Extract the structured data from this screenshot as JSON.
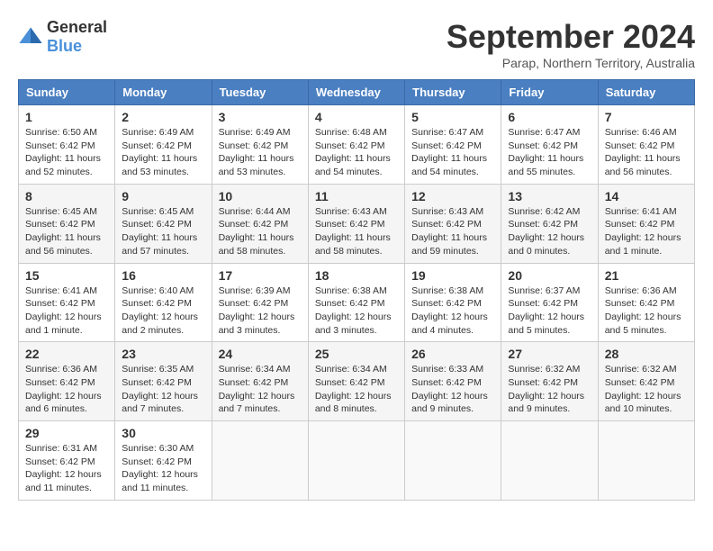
{
  "logo": {
    "general": "General",
    "blue": "Blue"
  },
  "title": "September 2024",
  "subtitle": "Parap, Northern Territory, Australia",
  "days_header": [
    "Sunday",
    "Monday",
    "Tuesday",
    "Wednesday",
    "Thursday",
    "Friday",
    "Saturday"
  ],
  "weeks": [
    [
      {
        "day": "1",
        "info": "Sunrise: 6:50 AM\nSunset: 6:42 PM\nDaylight: 11 hours and 52 minutes."
      },
      {
        "day": "2",
        "info": "Sunrise: 6:49 AM\nSunset: 6:42 PM\nDaylight: 11 hours and 53 minutes."
      },
      {
        "day": "3",
        "info": "Sunrise: 6:49 AM\nSunset: 6:42 PM\nDaylight: 11 hours and 53 minutes."
      },
      {
        "day": "4",
        "info": "Sunrise: 6:48 AM\nSunset: 6:42 PM\nDaylight: 11 hours and 54 minutes."
      },
      {
        "day": "5",
        "info": "Sunrise: 6:47 AM\nSunset: 6:42 PM\nDaylight: 11 hours and 54 minutes."
      },
      {
        "day": "6",
        "info": "Sunrise: 6:47 AM\nSunset: 6:42 PM\nDaylight: 11 hours and 55 minutes."
      },
      {
        "day": "7",
        "info": "Sunrise: 6:46 AM\nSunset: 6:42 PM\nDaylight: 11 hours and 56 minutes."
      }
    ],
    [
      {
        "day": "8",
        "info": "Sunrise: 6:45 AM\nSunset: 6:42 PM\nDaylight: 11 hours and 56 minutes."
      },
      {
        "day": "9",
        "info": "Sunrise: 6:45 AM\nSunset: 6:42 PM\nDaylight: 11 hours and 57 minutes."
      },
      {
        "day": "10",
        "info": "Sunrise: 6:44 AM\nSunset: 6:42 PM\nDaylight: 11 hours and 58 minutes."
      },
      {
        "day": "11",
        "info": "Sunrise: 6:43 AM\nSunset: 6:42 PM\nDaylight: 11 hours and 58 minutes."
      },
      {
        "day": "12",
        "info": "Sunrise: 6:43 AM\nSunset: 6:42 PM\nDaylight: 11 hours and 59 minutes."
      },
      {
        "day": "13",
        "info": "Sunrise: 6:42 AM\nSunset: 6:42 PM\nDaylight: 12 hours and 0 minutes."
      },
      {
        "day": "14",
        "info": "Sunrise: 6:41 AM\nSunset: 6:42 PM\nDaylight: 12 hours and 1 minute."
      }
    ],
    [
      {
        "day": "15",
        "info": "Sunrise: 6:41 AM\nSunset: 6:42 PM\nDaylight: 12 hours and 1 minute."
      },
      {
        "day": "16",
        "info": "Sunrise: 6:40 AM\nSunset: 6:42 PM\nDaylight: 12 hours and 2 minutes."
      },
      {
        "day": "17",
        "info": "Sunrise: 6:39 AM\nSunset: 6:42 PM\nDaylight: 12 hours and 3 minutes."
      },
      {
        "day": "18",
        "info": "Sunrise: 6:38 AM\nSunset: 6:42 PM\nDaylight: 12 hours and 3 minutes."
      },
      {
        "day": "19",
        "info": "Sunrise: 6:38 AM\nSunset: 6:42 PM\nDaylight: 12 hours and 4 minutes."
      },
      {
        "day": "20",
        "info": "Sunrise: 6:37 AM\nSunset: 6:42 PM\nDaylight: 12 hours and 5 minutes."
      },
      {
        "day": "21",
        "info": "Sunrise: 6:36 AM\nSunset: 6:42 PM\nDaylight: 12 hours and 5 minutes."
      }
    ],
    [
      {
        "day": "22",
        "info": "Sunrise: 6:36 AM\nSunset: 6:42 PM\nDaylight: 12 hours and 6 minutes."
      },
      {
        "day": "23",
        "info": "Sunrise: 6:35 AM\nSunset: 6:42 PM\nDaylight: 12 hours and 7 minutes."
      },
      {
        "day": "24",
        "info": "Sunrise: 6:34 AM\nSunset: 6:42 PM\nDaylight: 12 hours and 7 minutes."
      },
      {
        "day": "25",
        "info": "Sunrise: 6:34 AM\nSunset: 6:42 PM\nDaylight: 12 hours and 8 minutes."
      },
      {
        "day": "26",
        "info": "Sunrise: 6:33 AM\nSunset: 6:42 PM\nDaylight: 12 hours and 9 minutes."
      },
      {
        "day": "27",
        "info": "Sunrise: 6:32 AM\nSunset: 6:42 PM\nDaylight: 12 hours and 9 minutes."
      },
      {
        "day": "28",
        "info": "Sunrise: 6:32 AM\nSunset: 6:42 PM\nDaylight: 12 hours and 10 minutes."
      }
    ],
    [
      {
        "day": "29",
        "info": "Sunrise: 6:31 AM\nSunset: 6:42 PM\nDaylight: 12 hours and 11 minutes."
      },
      {
        "day": "30",
        "info": "Sunrise: 6:30 AM\nSunset: 6:42 PM\nDaylight: 12 hours and 11 minutes."
      },
      {
        "day": "",
        "info": ""
      },
      {
        "day": "",
        "info": ""
      },
      {
        "day": "",
        "info": ""
      },
      {
        "day": "",
        "info": ""
      },
      {
        "day": "",
        "info": ""
      }
    ]
  ]
}
